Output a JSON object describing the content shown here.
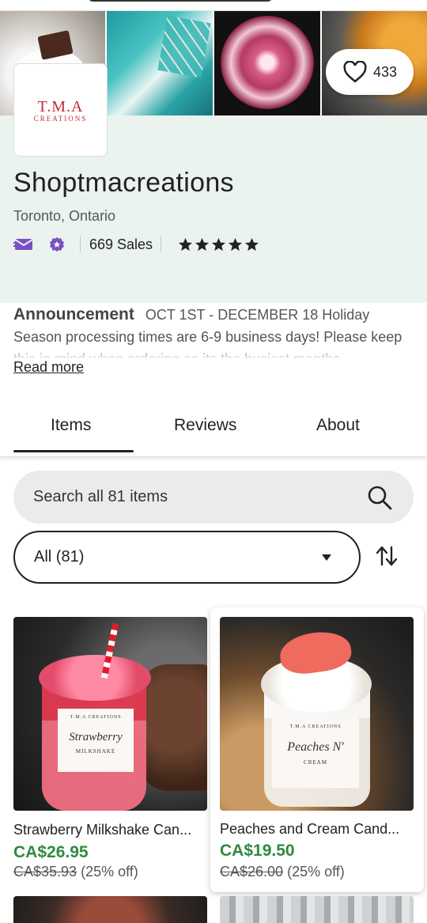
{
  "favorites": {
    "count": "433"
  },
  "shop": {
    "logo_main_prefix": "T.M.A",
    "logo_sub": "CREATIONS",
    "name": "Shoptmacreations",
    "location": "Toronto, Ontario",
    "sales": "669 Sales",
    "rating_stars": 5
  },
  "announcement": {
    "title": "Announcement",
    "text": "OCT 1ST - DECEMBER 18 Holiday Season processing times are 6-9 business days! Please keep this in mind when ordering as its the busiest months",
    "read_more": "Read more"
  },
  "tabs": [
    {
      "label": "Items",
      "active": true
    },
    {
      "label": "Reviews",
      "active": false
    },
    {
      "label": "About",
      "active": false
    }
  ],
  "search": {
    "placeholder": "Search all 81 items"
  },
  "filter": {
    "selected": "All (81)"
  },
  "listings": [
    {
      "title": "Strawberry Milkshake Can...",
      "price": "CA$26.95",
      "original_price": "CA$35.93",
      "discount": "(25% off)",
      "label_line1": "T.M.A CREATIONS",
      "label_line2": "Strawberry",
      "label_line3": "MILKSHAKE"
    },
    {
      "title": "Peaches and Cream Cand...",
      "price": "CA$19.50",
      "original_price": "CA$26.00",
      "discount": "(25% off)",
      "label_line1": "T.M.A CREATIONS",
      "label_line2": "Peaches N'",
      "label_line3": "CREAM"
    }
  ],
  "colors": {
    "header_bg": "#eaf3ee",
    "price_green": "#2f8a3d",
    "icon_purple": "#7a4fc4"
  },
  "icons": [
    "heart-icon",
    "message-icon",
    "star-seller-icon",
    "search-icon",
    "chevron-down-icon",
    "sort-icon",
    "star-icon"
  ]
}
